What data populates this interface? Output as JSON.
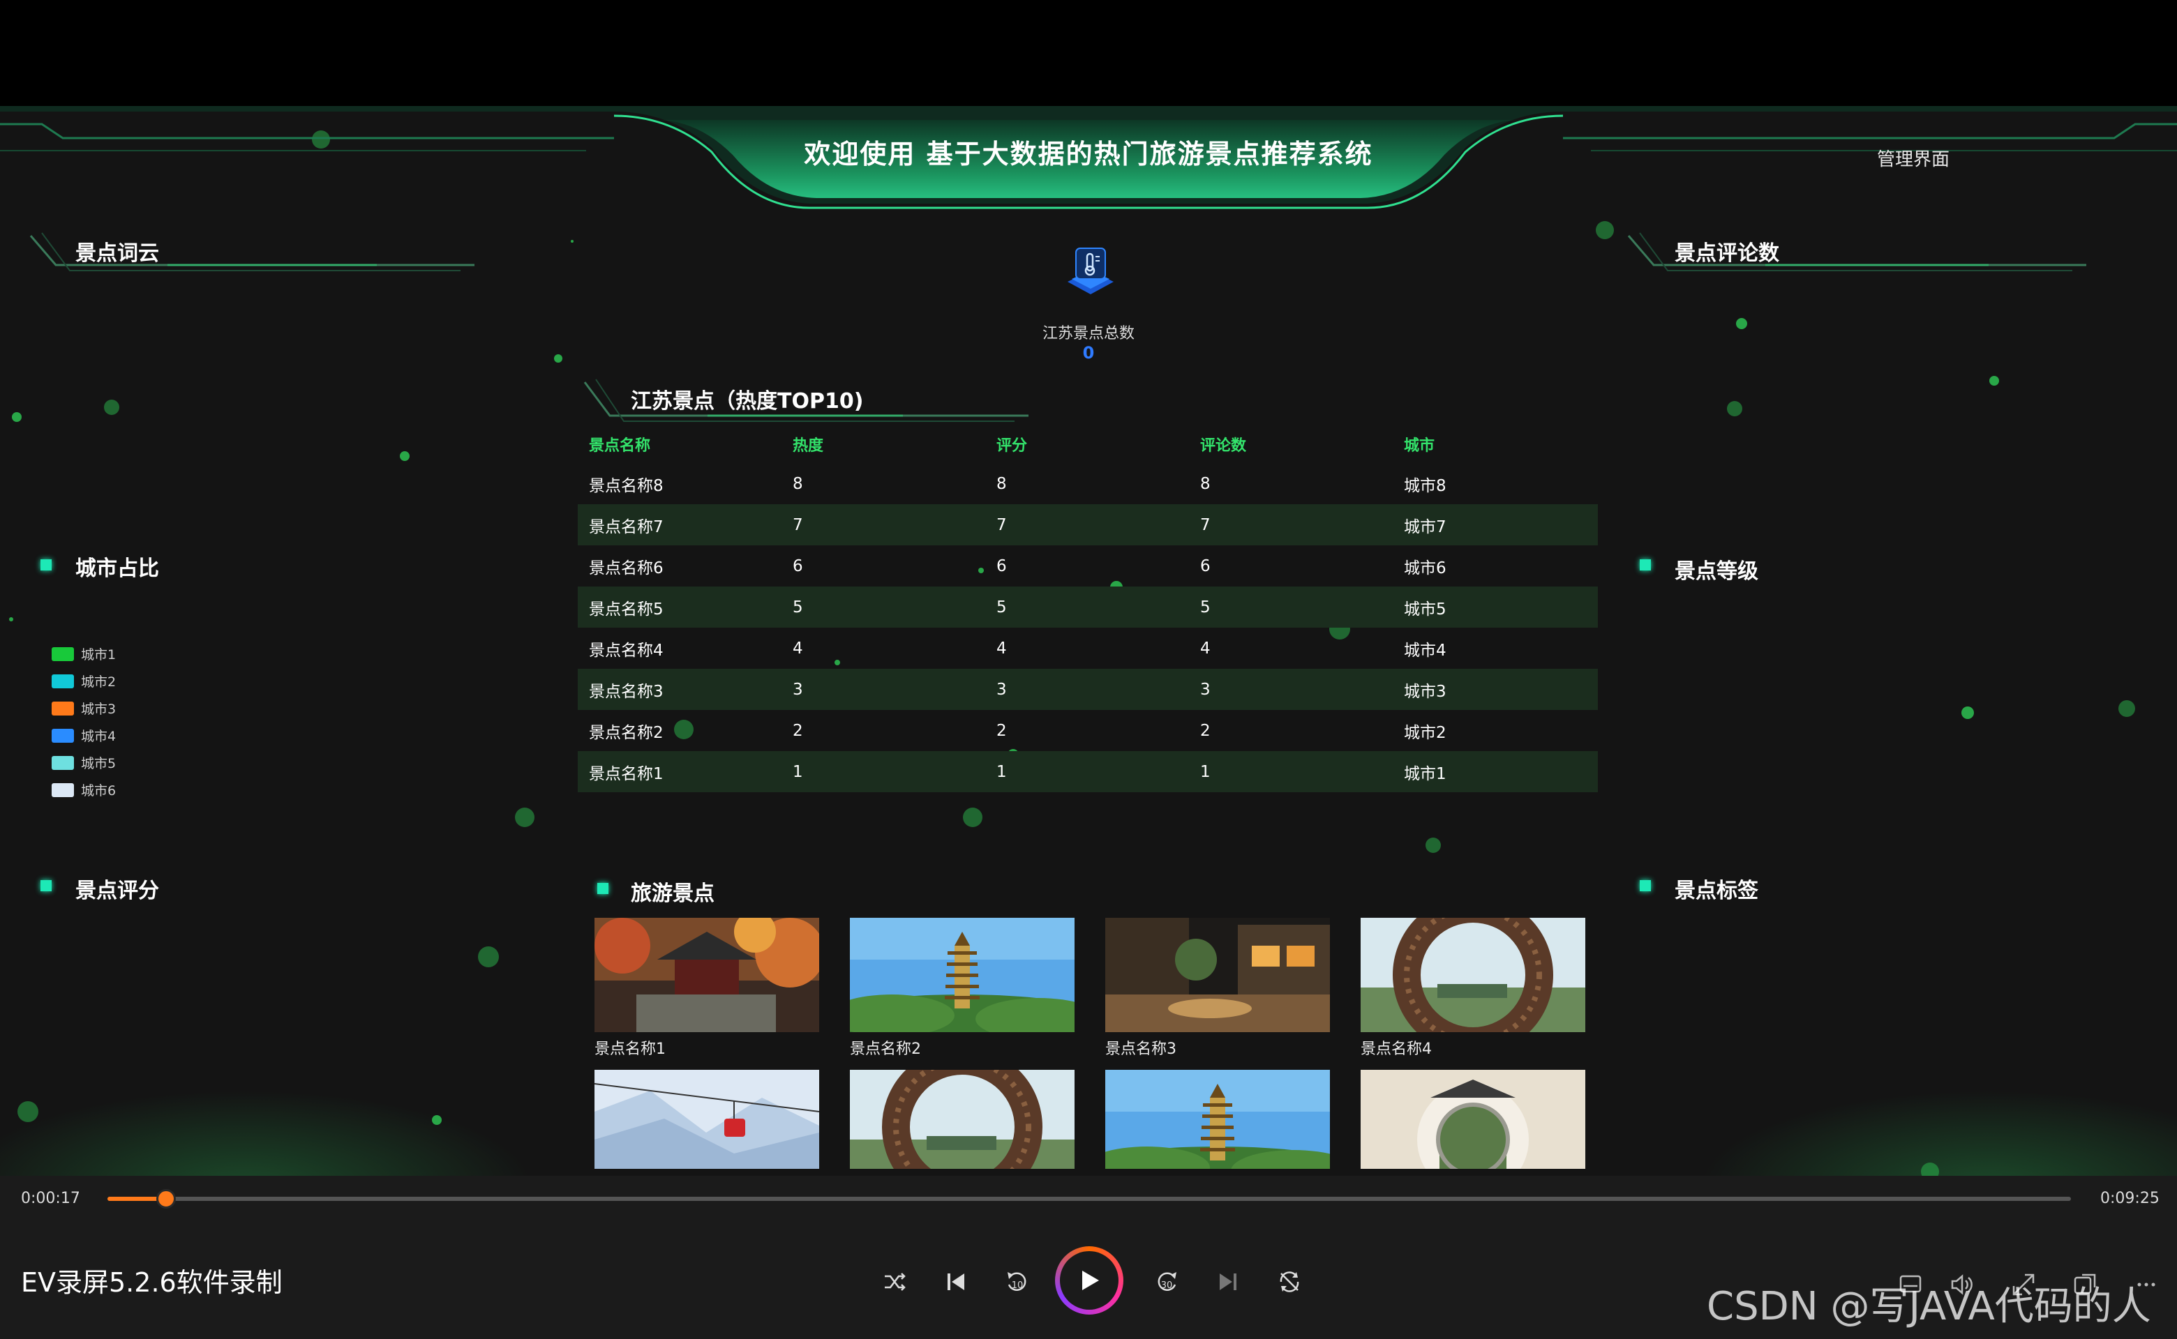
{
  "header": {
    "title": "欢迎使用 基于大数据的热门旅游景点推荐系统",
    "admin_link": "管理界面"
  },
  "sections": {
    "word_cloud": "景点词云",
    "city_ratio": "城市占比",
    "rating": "景点评分",
    "comment_count": "景点评论数",
    "level": "景点等级",
    "tags": "景点标签",
    "top10": "江苏景点（热度TOP10)",
    "gallery": "旅游景点"
  },
  "summary": {
    "label": "江苏景点总数",
    "value": "0"
  },
  "table": {
    "headers": [
      "景点名称",
      "热度",
      "评分",
      "评论数",
      "城市"
    ],
    "rows": [
      [
        "景点名称8",
        "8",
        "8",
        "8",
        "城市8"
      ],
      [
        "景点名称7",
        "7",
        "7",
        "7",
        "城市7"
      ],
      [
        "景点名称6",
        "6",
        "6",
        "6",
        "城市6"
      ],
      [
        "景点名称5",
        "5",
        "5",
        "5",
        "城市5"
      ],
      [
        "景点名称4",
        "4",
        "4",
        "4",
        "城市4"
      ],
      [
        "景点名称3",
        "3",
        "3",
        "3",
        "城市3"
      ],
      [
        "景点名称2",
        "2",
        "2",
        "2",
        "城市2"
      ],
      [
        "景点名称1",
        "1",
        "1",
        "1",
        "城市1"
      ]
    ]
  },
  "legend": [
    {
      "label": "城市1",
      "color": "#18c93a"
    },
    {
      "label": "城市2",
      "color": "#11c9d8"
    },
    {
      "label": "城市3",
      "color": "#ff7a1a"
    },
    {
      "label": "城市4",
      "color": "#2a8cff"
    },
    {
      "label": "城市5",
      "color": "#6ee0e0"
    },
    {
      "label": "城市6",
      "color": "#dce8f5"
    }
  ],
  "gallery": [
    {
      "caption": "景点名称1",
      "scene": "pavilion"
    },
    {
      "caption": "景点名称2",
      "scene": "pagoda"
    },
    {
      "caption": "景点名称3",
      "scene": "night-street"
    },
    {
      "caption": "景点名称4",
      "scene": "nest-arch"
    },
    {
      "caption": "",
      "scene": "snow-cablecar"
    },
    {
      "caption": "",
      "scene": "nest-arch"
    },
    {
      "caption": "",
      "scene": "pagoda"
    },
    {
      "caption": "",
      "scene": "moon-gate"
    }
  ],
  "player": {
    "current_time": "0:00:17",
    "total_time": "0:09:25",
    "progress": 0.03,
    "recorder_title": "EV录屏5.2.6软件录制",
    "controls": [
      "shuffle-icon",
      "previous-icon",
      "rewind-10-icon",
      "play-icon",
      "forward-30-icon",
      "next-icon",
      "repeat-icon"
    ]
  },
  "watermark": "CSDN @写JAVA代码的人",
  "colors": {
    "accent_green": "#33e36b",
    "accent_teal": "#1de9b6",
    "total_blue": "#2f7bff",
    "progress_orange": "#ff7a1a"
  }
}
